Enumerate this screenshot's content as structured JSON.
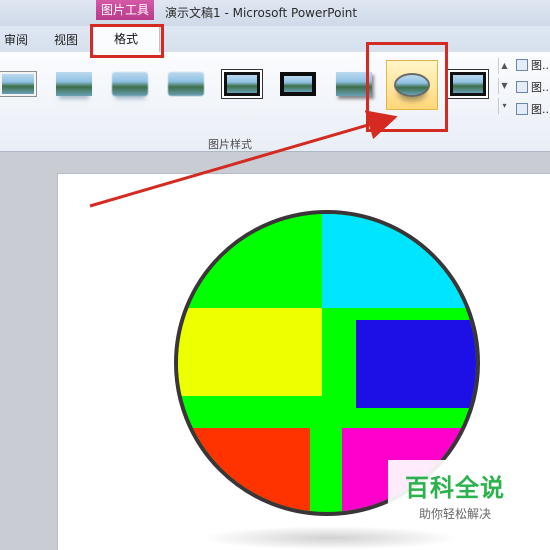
{
  "window": {
    "context_tab_group": "图片工具",
    "title": "演示文稿1 - Microsoft PowerPoint"
  },
  "tabs": [
    {
      "label": "审阅"
    },
    {
      "label": "视图"
    },
    {
      "label": "格式",
      "active": true
    }
  ],
  "ribbon": {
    "picture_styles": [
      {
        "name": "simple-frame-white"
      },
      {
        "name": "reflected-rounded"
      },
      {
        "name": "soft-edge"
      },
      {
        "name": "drop-shadow"
      },
      {
        "name": "thick-black-frame"
      },
      {
        "name": "metal-frame"
      },
      {
        "name": "shadow-rectangle"
      },
      {
        "name": "reflected-bevel-oval",
        "selected": true
      },
      {
        "name": "double-frame-black"
      }
    ],
    "side_commands": [
      {
        "label": "图...",
        "icon": "picture-border-icon"
      },
      {
        "label": "图...",
        "icon": "picture-effects-icon"
      },
      {
        "label": "图...",
        "icon": "picture-layout-icon"
      }
    ],
    "group_label": "图片样式"
  },
  "slide": {
    "picture_colors": {
      "green": "#00ff00",
      "cyan": "#00e5ff",
      "yellow": "#eeff00",
      "blue": "#1c10e6",
      "red": "#ff3300",
      "magenta": "#ff00cc",
      "border": "#3b3438"
    }
  },
  "annotation": {
    "highlight_color": "#d52a22"
  },
  "watermark": {
    "main": "百科全说",
    "sub": "助你轻松解决"
  }
}
